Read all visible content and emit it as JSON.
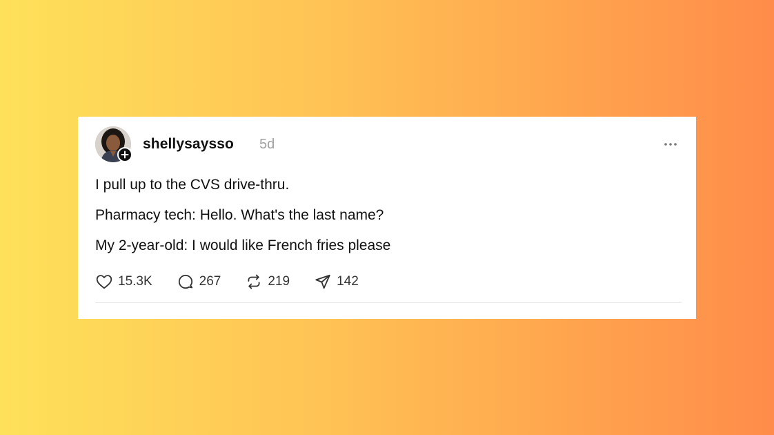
{
  "post": {
    "username": "shellysaysso",
    "timestamp": "5d",
    "lines": [
      "I pull up to the CVS drive-thru.",
      "Pharmacy tech: Hello. What's the last name?",
      "My 2-year-old: I would like French fries please"
    ],
    "stats": {
      "likes": "15.3K",
      "replies": "267",
      "reposts": "219",
      "shares": "142"
    }
  },
  "icons": {
    "more": "more-horizontal-icon",
    "like": "heart-icon",
    "reply": "comment-bubble-icon",
    "repost": "repost-arrows-icon",
    "share": "send-paper-plane-icon",
    "follow": "plus-icon"
  },
  "colors": {
    "gradient_start": "#fee15a",
    "gradient_end": "#ff8c4a",
    "card_bg": "#ffffff",
    "text": "#101010",
    "muted": "#a0a0a0"
  }
}
